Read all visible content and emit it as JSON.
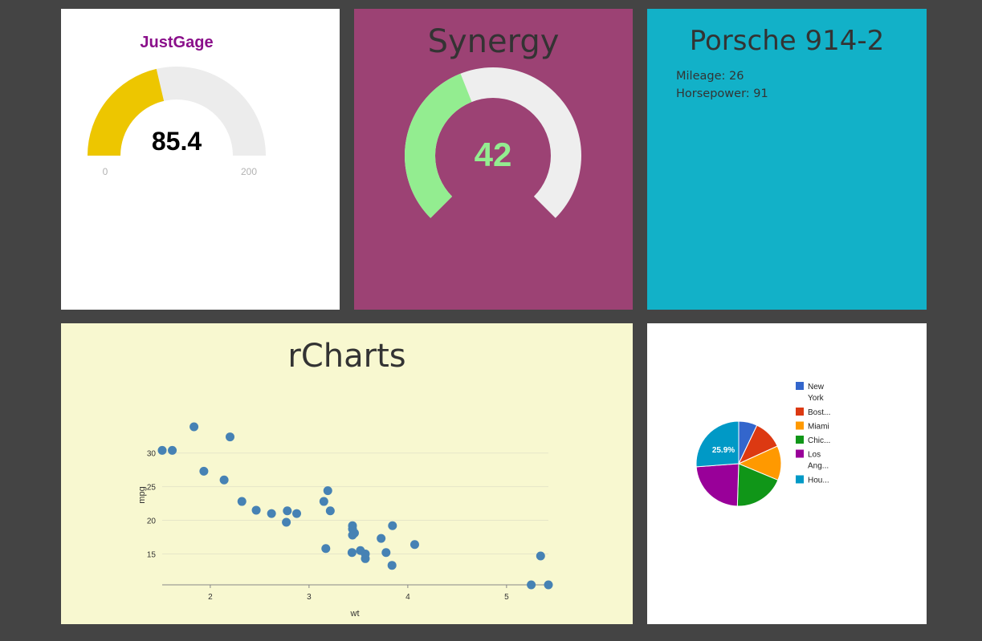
{
  "justgage": {
    "title": "JustGage",
    "value": 85.4,
    "value_text": "85.4",
    "min": 0,
    "max": 200,
    "min_label": "0",
    "max_label": "200",
    "colors": {
      "title": "#8a0f8a",
      "fill": "#edc600",
      "track": "#ececec",
      "value": "#000000",
      "label": "#b3b3b3"
    }
  },
  "synergy": {
    "title": "Synergy",
    "value": 42,
    "value_text": "42",
    "min": 0,
    "max": 100,
    "colors": {
      "background": "#9c4274",
      "fill": "#93ed90",
      "track": "#eeeeee",
      "value": "#93ed90"
    }
  },
  "porsche": {
    "title": "Porsche 914-2",
    "mileage_label": "Mileage: 26",
    "horsepower_label": "Horsepower: 91",
    "colors": {
      "background": "#12b1c8"
    }
  },
  "rcharts": {
    "title": "rCharts",
    "colors": {
      "background": "#f8f8d0",
      "point": "#4682b4"
    }
  },
  "chart_data": [
    {
      "type": "scatter",
      "title": "rCharts",
      "xlabel": "wt",
      "ylabel": "mpg",
      "xlim": [
        1.513,
        5.424
      ],
      "ylim": [
        10.4,
        33.9
      ],
      "x_ticks": [
        "2",
        "3",
        "4",
        "5"
      ],
      "y_ticks": [
        "15",
        "20",
        "25",
        "30"
      ],
      "x_tick_values": [
        2,
        3,
        4,
        5
      ],
      "y_tick_values": [
        15,
        20,
        25,
        30
      ],
      "grid": "horizontal",
      "points": [
        {
          "x": 2.62,
          "y": 21.0
        },
        {
          "x": 2.875,
          "y": 21.0
        },
        {
          "x": 2.32,
          "y": 22.8
        },
        {
          "x": 3.215,
          "y": 21.4
        },
        {
          "x": 3.44,
          "y": 18.7
        },
        {
          "x": 3.46,
          "y": 18.1
        },
        {
          "x": 3.57,
          "y": 14.3
        },
        {
          "x": 3.19,
          "y": 24.4
        },
        {
          "x": 3.15,
          "y": 22.8
        },
        {
          "x": 3.44,
          "y": 19.2
        },
        {
          "x": 3.44,
          "y": 17.8
        },
        {
          "x": 4.07,
          "y": 16.4
        },
        {
          "x": 3.73,
          "y": 17.3
        },
        {
          "x": 3.78,
          "y": 15.2
        },
        {
          "x": 5.25,
          "y": 10.4
        },
        {
          "x": 5.424,
          "y": 10.4
        },
        {
          "x": 5.345,
          "y": 14.7
        },
        {
          "x": 2.2,
          "y": 32.4
        },
        {
          "x": 1.615,
          "y": 30.4
        },
        {
          "x": 1.835,
          "y": 33.9
        },
        {
          "x": 2.465,
          "y": 21.5
        },
        {
          "x": 3.52,
          "y": 15.5
        },
        {
          "x": 3.435,
          "y": 15.2
        },
        {
          "x": 3.84,
          "y": 13.3
        },
        {
          "x": 3.845,
          "y": 19.2
        },
        {
          "x": 1.935,
          "y": 27.3
        },
        {
          "x": 2.14,
          "y": 26.0
        },
        {
          "x": 1.513,
          "y": 30.4
        },
        {
          "x": 3.17,
          "y": 15.8
        },
        {
          "x": 2.77,
          "y": 19.7
        },
        {
          "x": 3.57,
          "y": 15.0
        },
        {
          "x": 2.78,
          "y": 21.4
        }
      ]
    },
    {
      "type": "pie",
      "legend": "right",
      "slices": [
        {
          "label": "New York",
          "legend_lines": [
            "New",
            "York"
          ],
          "value": 7.0,
          "color": "#3366cc"
        },
        {
          "label": "Boston",
          "legend_lines": [
            "Bost..."
          ],
          "value": 11.0,
          "color": "#dc3912"
        },
        {
          "label": "Miami",
          "legend_lines": [
            "Miami"
          ],
          "value": 13.0,
          "color": "#ff9900"
        },
        {
          "label": "Chicago",
          "legend_lines": [
            "Chic..."
          ],
          "value": 19.0,
          "color": "#109618"
        },
        {
          "label": "Los Angeles",
          "legend_lines": [
            "Los",
            "Ang..."
          ],
          "value": 23.1,
          "color": "#990099"
        },
        {
          "label": "Houston",
          "legend_lines": [
            "Hou..."
          ],
          "value": 25.9,
          "color": "#0099c6"
        }
      ],
      "data_label": "25.9%"
    }
  ]
}
